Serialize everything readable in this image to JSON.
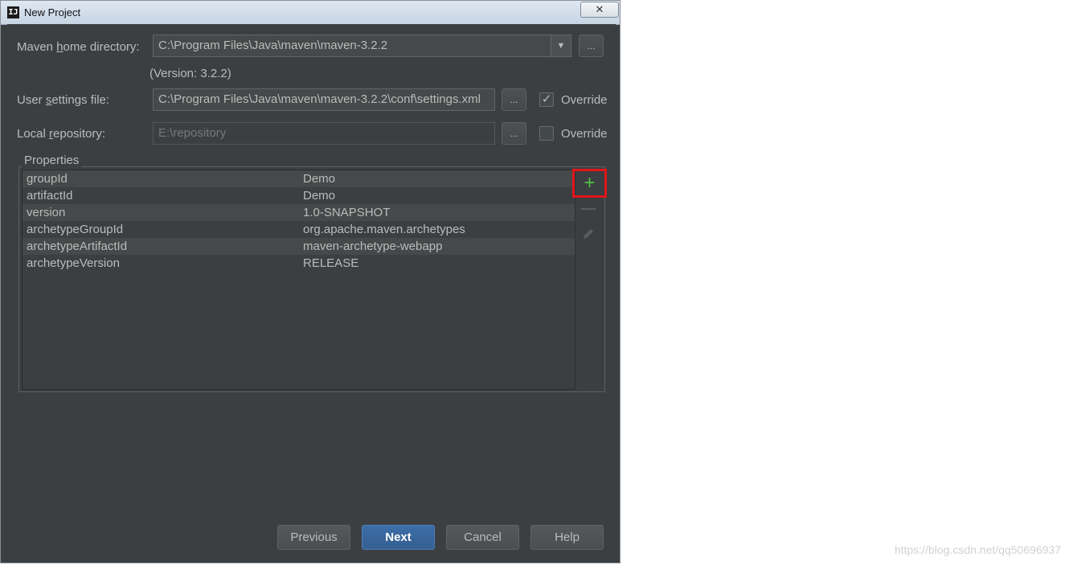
{
  "window": {
    "title": "New Project",
    "app_icon_text": "IJ",
    "close_label": "✕"
  },
  "form": {
    "maven_home": {
      "label_pre": "Maven ",
      "label_mnemonic": "h",
      "label_post": "ome directory:",
      "value": "C:\\Program Files\\Java\\maven\\maven-3.2.2",
      "version_note": "(Version: 3.2.2)",
      "dropdown_arrow": "▼",
      "browse_label": "..."
    },
    "user_settings": {
      "label_pre": "User ",
      "label_mnemonic": "s",
      "label_post": "ettings file:",
      "value": "C:\\Program Files\\Java\\maven\\maven-3.2.2\\conf\\settings.xml",
      "browse_label": "...",
      "override_label": "Override",
      "override_checked": true,
      "check_mark": "✓"
    },
    "local_repo": {
      "label_pre": "Local ",
      "label_mnemonic": "r",
      "label_post": "epository:",
      "value": "E:\\repository",
      "browse_label": "...",
      "override_label": "Override",
      "override_checked": false
    }
  },
  "properties": {
    "legend": "Properties",
    "rows": [
      {
        "key": "groupId",
        "value": "Demo"
      },
      {
        "key": "artifactId",
        "value": "Demo"
      },
      {
        "key": "version",
        "value": "1.0-SNAPSHOT"
      },
      {
        "key": "archetypeGroupId",
        "value": "org.apache.maven.archetypes"
      },
      {
        "key": "archetypeArtifactId",
        "value": "maven-archetype-webapp"
      },
      {
        "key": "archetypeVersion",
        "value": "RELEASE"
      }
    ],
    "toolbar": {
      "add_icon": "+",
      "highlight_color": "#e0161b"
    }
  },
  "buttons": {
    "previous": "Previous",
    "next": "Next",
    "cancel": "Cancel",
    "help": "Help"
  },
  "watermark": "https://blog.csdn.net/qq50696937",
  "colors": {
    "dialog_bg": "#3c3f41",
    "primary_button": "#365f91",
    "add_icon": "#4fbf45"
  }
}
